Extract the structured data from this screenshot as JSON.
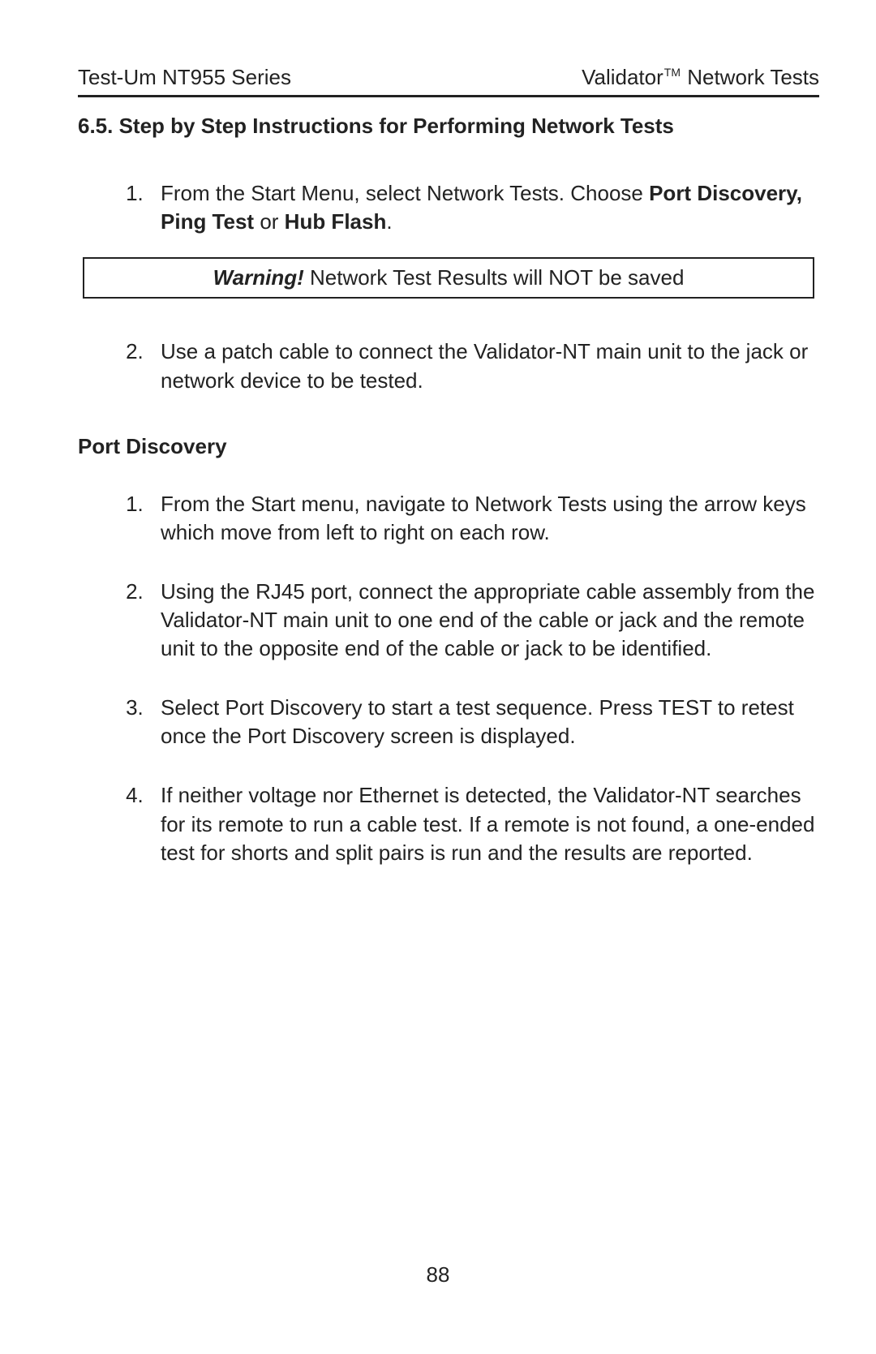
{
  "header": {
    "left": "Test-Um NT955 Series",
    "right_pre": "Validator",
    "right_tm": "TM",
    "right_post": " Network Tests"
  },
  "section_title": "6.5. Step by Step Instructions for Performing Network Tests",
  "intro_steps": {
    "s1_a": "From the Start Menu, select Network Tests.  Choose ",
    "s1_b": "Port Discovery, Ping Test",
    "s1_c": " or ",
    "s1_d": "Hub Flash",
    "s1_e": ".",
    "s2": "Use a patch cable to connect the Validator-NT main unit to the jack or network device to be tested."
  },
  "warning": {
    "label": "Warning!",
    "text": " Network Test Results will NOT be saved"
  },
  "subheading": "Port Discovery",
  "pd_steps": {
    "p1": "From the Start menu, navigate to Network Tests using the arrow keys which move from left to right on each row.",
    "p2": "Using the RJ45 port, connect the appropriate cable assembly from the Validator-NT main unit to one end of the cable or jack and the remote unit to the opposite end of the cable or jack to be identified.",
    "p3": "Select Port Discovery to start a test sequence.  Press TEST to retest once the Port Discovery screen is displayed.",
    "p4": "If neither voltage nor Ethernet is detected, the Validator-NT searches for its remote to run a cable test.  If a remote is not found, a one-ended test for shorts and split pairs is run and the results are reported."
  },
  "page_number": "88"
}
